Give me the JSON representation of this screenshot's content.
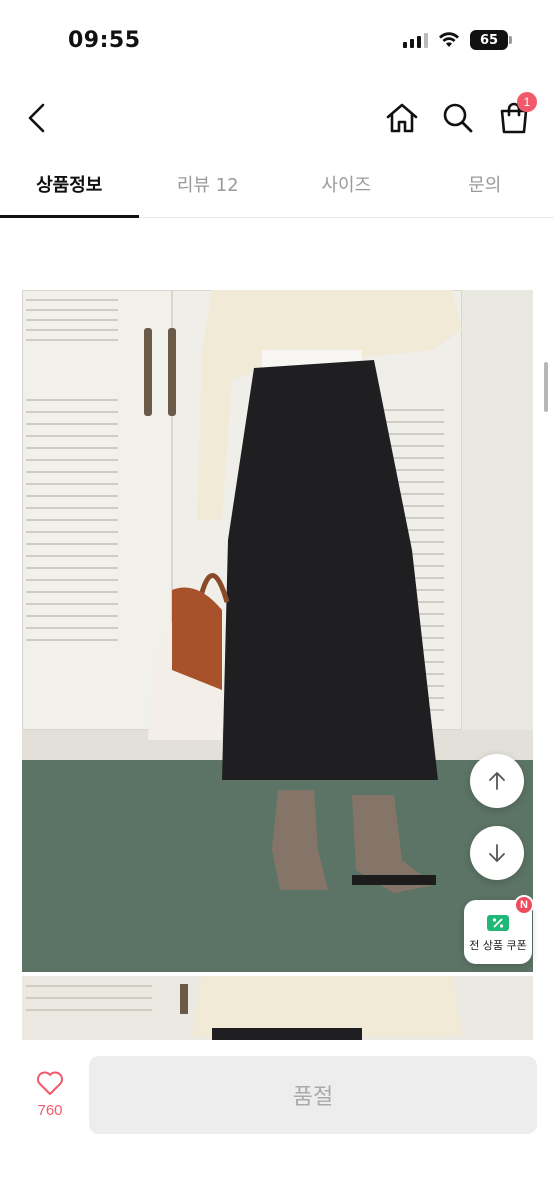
{
  "status_bar": {
    "time": "09:55",
    "battery": "65"
  },
  "header": {
    "back_icon": "chevron-left-icon",
    "home_icon": "home-icon",
    "search_icon": "search-icon",
    "cart_icon": "shopping-bag-icon",
    "cart_badge": "1"
  },
  "tabs": [
    {
      "label": "상품정보",
      "active": true
    },
    {
      "label": "리뷰 12",
      "active": false
    },
    {
      "label": "사이즈",
      "active": false
    },
    {
      "label": "문의",
      "active": false
    }
  ],
  "floating": {
    "up_icon": "arrow-up-icon",
    "down_icon": "arrow-down-icon",
    "coupon_label": "전 상품 쿠폰",
    "coupon_badge": "N"
  },
  "bottom_bar": {
    "like_icon": "heart-icon",
    "like_count": "760",
    "buy_label": "품절"
  },
  "colors": {
    "accent": "#f25a6b",
    "coupon_green": "#1fb877",
    "disabled_bg": "#ededed",
    "disabled_text": "#aaaaaa"
  }
}
